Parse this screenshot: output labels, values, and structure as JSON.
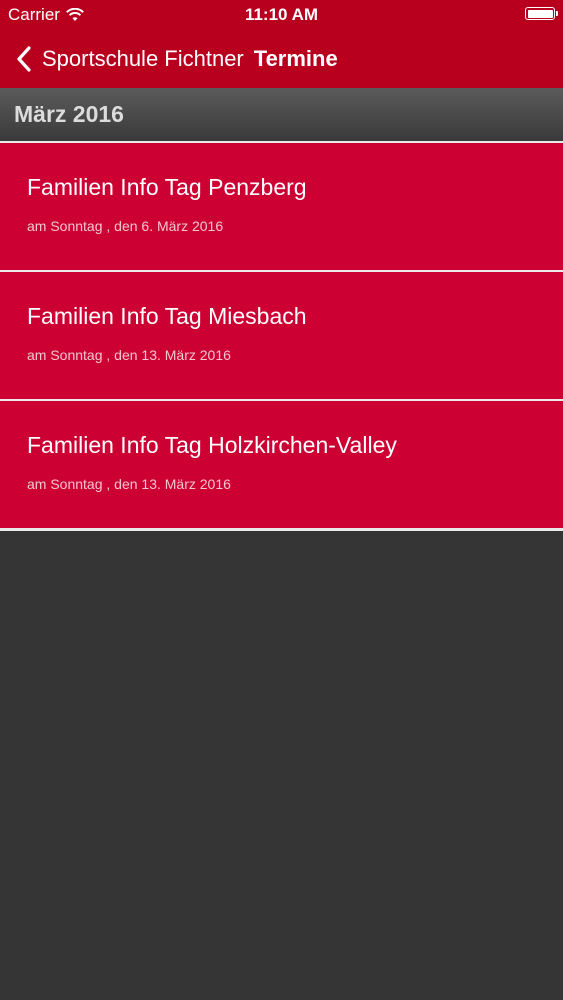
{
  "status_bar": {
    "carrier": "Carrier",
    "time": "11:10 AM"
  },
  "nav": {
    "back_label": "Sportschule Fichtner",
    "title": "Termine"
  },
  "section": {
    "title": "März 2016"
  },
  "events": [
    {
      "title": "Familien Info Tag Penzberg",
      "date": "am Sonntag , den 6. März 2016"
    },
    {
      "title": "Familien Info Tag Miesbach",
      "date": "am Sonntag , den 13. März 2016"
    },
    {
      "title": "Familien Info Tag Holzkirchen-Valley",
      "date": "am Sonntag , den 13. März 2016"
    }
  ],
  "colors": {
    "nav_background": "#b8001e",
    "row_background": "#cc0033",
    "page_background": "#353535"
  }
}
